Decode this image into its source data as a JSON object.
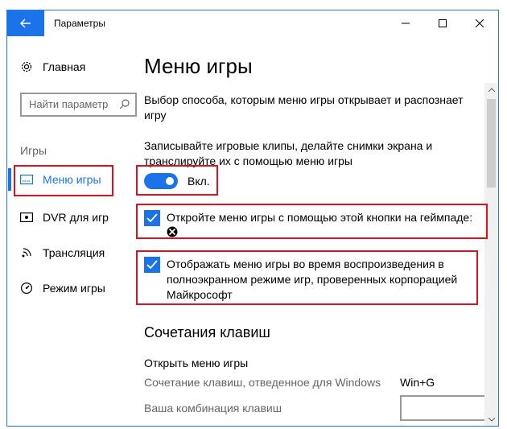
{
  "window": {
    "title": "Параметры",
    "accent": "#1a73e8",
    "highlight": "#e0101c"
  },
  "sidebar": {
    "home_label": "Главная",
    "search_placeholder": "Найти параметр",
    "section_label": "Игры",
    "items": [
      {
        "label": "Меню игры",
        "icon": "game-bar-icon",
        "active": true
      },
      {
        "label": "DVR для игр",
        "icon": "dvr-icon",
        "active": false
      },
      {
        "label": "Трансляция",
        "icon": "broadcast-icon",
        "active": false
      },
      {
        "label": "Режим игры",
        "icon": "game-mode-icon",
        "active": false
      }
    ]
  },
  "main": {
    "title": "Меню игры",
    "description": "Выбор способа, которым меню игры открывает и распознает игру",
    "record_description": "Записывайте игровые клипы, делайте снимки экрана и транслируйте их с помощью меню игры",
    "toggle_label": "Вкл.",
    "checkbox1_label": "Откройте меню игры с помощью этой кнопки на геймпаде:",
    "checkbox2_label": "Отображать меню игры во время воспроизведения в полноэкранном режиме игр, проверенных корпорацией Майкрософт",
    "shortcuts_heading": "Сочетания клавиш",
    "open_menu_label": "Открыть меню игры",
    "default_shortcut_label": "Сочетание клавиш, отведенное для Windows",
    "default_shortcut_value": "Win+G",
    "custom_shortcut_label": "Ваша комбинация клавиш"
  }
}
